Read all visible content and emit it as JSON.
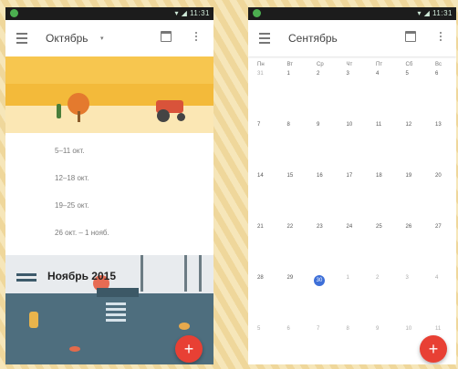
{
  "left": {
    "status": {
      "text": "▾ ◢ 11:31"
    },
    "appbar": {
      "title": "Октябрь"
    },
    "weeks": [
      "5–11 окт.",
      "12–18 окт.",
      "19–25 окт.",
      "26 окт. – 1 нояб."
    ],
    "november_title": "Ноябрь 2015",
    "fab_label": "+"
  },
  "right": {
    "status": {
      "text": "▾ ◢ 11:31"
    },
    "appbar": {
      "title": "Сентябрь"
    },
    "weekdays": [
      "Пн",
      "Вт",
      "Ср",
      "Чт",
      "Пт",
      "Сб",
      "Вс"
    ],
    "weeks": [
      [
        "31",
        "1",
        "2",
        "3",
        "4",
        "5",
        "6"
      ],
      [
        "7",
        "8",
        "9",
        "10",
        "11",
        "12",
        "13"
      ],
      [
        "14",
        "15",
        "16",
        "17",
        "18",
        "19",
        "20"
      ],
      [
        "21",
        "22",
        "23",
        "24",
        "25",
        "26",
        "27"
      ],
      [
        "28",
        "29",
        "30",
        "1",
        "2",
        "3",
        "4"
      ],
      [
        "5",
        "6",
        "7",
        "8",
        "9",
        "10",
        "11"
      ]
    ],
    "today": "30",
    "fab_label": "+"
  },
  "colors": {
    "accent": "#e84034",
    "today": "#3d6fd8",
    "status_bar": "#1c1c1c"
  }
}
